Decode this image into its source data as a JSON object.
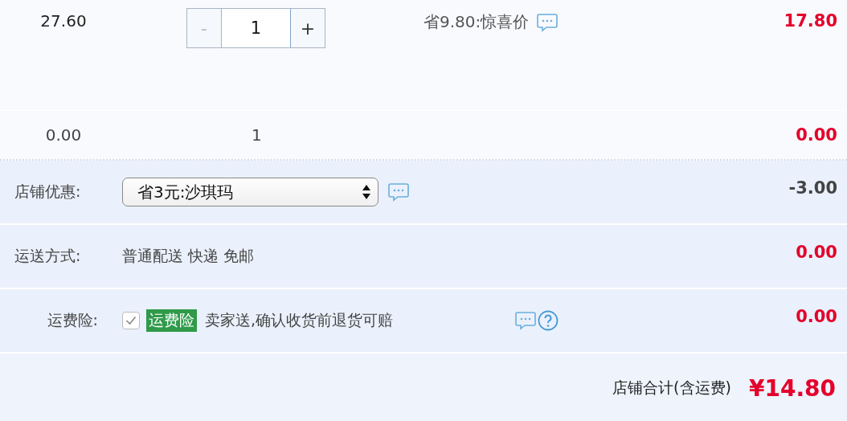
{
  "items": [
    {
      "unit_price": "27.60",
      "quantity": {
        "kind": "stepper",
        "value": "1",
        "minus": {
          "label": "-",
          "disabled": true
        },
        "plus": {
          "label": "+",
          "disabled": false
        }
      },
      "promotion": "省9.80:惊喜价",
      "subtotal": "17.80"
    },
    {
      "unit_price": "0.00",
      "quantity": {
        "kind": "plain",
        "value": "1"
      },
      "subtotal": "0.00"
    }
  ],
  "shop_discount": {
    "label": "店铺优惠:",
    "selected_option": "省3元:沙琪玛",
    "amount": "-3.00"
  },
  "shipping": {
    "label": "运送方式:",
    "method": "普通配送 快递 免邮",
    "amount": "0.00"
  },
  "insurance": {
    "label": "运费险:",
    "checked": true,
    "badge": "运费险",
    "description": "卖家送,确认收货前退货可赔",
    "amount": "0.00"
  },
  "total": {
    "label": "店铺合计(含运费)",
    "amount": "¥14.80"
  }
}
